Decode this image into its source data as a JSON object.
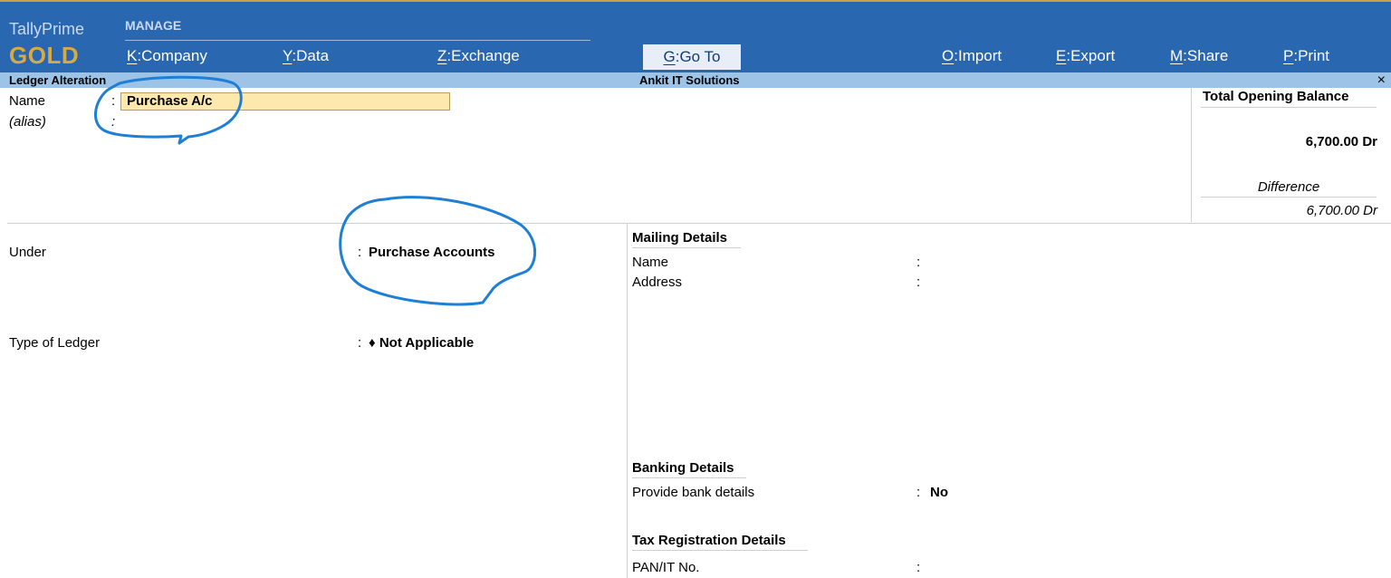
{
  "header": {
    "app_name": "TallyPrime",
    "edition": "GOLD",
    "section_label": "MANAGE",
    "menu": [
      {
        "key": "K",
        "label": "Company"
      },
      {
        "key": "Y",
        "label": "Data"
      },
      {
        "key": "Z",
        "label": "Exchange"
      },
      {
        "key": "G",
        "label": "Go To"
      },
      {
        "key": "O",
        "label": "Import"
      },
      {
        "key": "E",
        "label": "Export"
      },
      {
        "key": "M",
        "label": "Share"
      },
      {
        "key": "P",
        "label": "Print"
      }
    ]
  },
  "subbar": {
    "screen_title": "Ledger Alteration",
    "company": "Ankit IT Solutions",
    "close_glyph": "×"
  },
  "form": {
    "name_label": "Name",
    "name_value": "Purchase A/c",
    "alias_label": "(alias)",
    "under_label": "Under",
    "under_value": "Purchase Accounts",
    "type_label": "Type of Ledger",
    "type_value": "♦ Not Applicable",
    "colon": ":"
  },
  "balance": {
    "title": "Total Opening Balance",
    "amount": "6,700.00 Dr",
    "difference_label": "Difference",
    "difference_amount": "6,700.00 Dr"
  },
  "mailing": {
    "heading": "Mailing Details",
    "name_label": "Name",
    "address_label": "Address"
  },
  "banking": {
    "heading": "Banking Details",
    "provide_label": "Provide bank details",
    "provide_value": "No"
  },
  "tax": {
    "heading": "Tax Registration Details",
    "pan_label": "PAN/IT No."
  },
  "colors": {
    "header_bg": "#2a67b1",
    "subbar_bg": "#9dc3e6",
    "edition_gold": "#d6aa45",
    "field_highlight": "#fde9ad",
    "annotation_blue": "#1f7fd4"
  }
}
